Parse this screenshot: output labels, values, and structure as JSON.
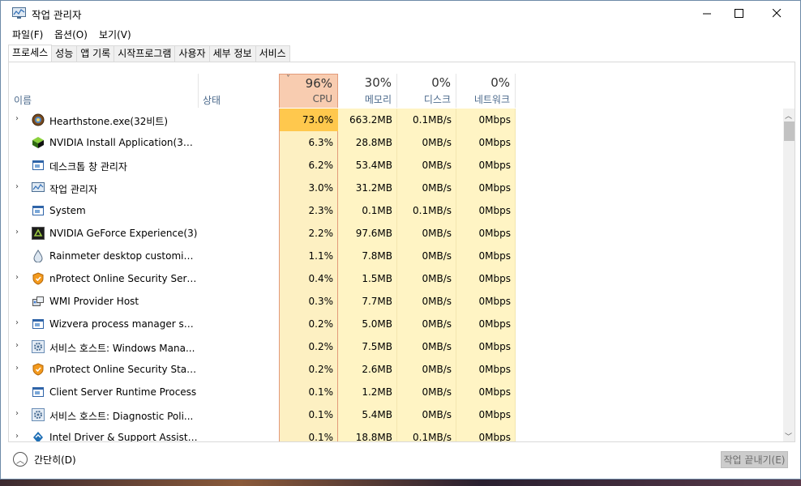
{
  "window": {
    "title": "작업 관리자"
  },
  "menu": [
    "파일(F)",
    "옵션(O)",
    "보기(V)"
  ],
  "tabs": [
    "프로세스",
    "성능",
    "앱 기록",
    "시작프로그램",
    "사용자",
    "세부 정보",
    "서비스"
  ],
  "header": {
    "name": "이름",
    "status": "상태",
    "cpu": {
      "pct": "96%",
      "label": "CPU"
    },
    "memory": {
      "pct": "30%",
      "label": "메모리"
    },
    "disk": {
      "pct": "0%",
      "label": "디스크"
    },
    "network": {
      "pct": "0%",
      "label": "네트워크"
    }
  },
  "processes": [
    {
      "name": "Hearthstone.exe(32비트)",
      "cpu": "73.0%",
      "mem": "663.2MB",
      "disk": "0.1MB/s",
      "net": "0Mbps",
      "icon": "hearthstone-icon"
    },
    {
      "name": "NVIDIA Install Application(32...",
      "cpu": "6.3%",
      "mem": "28.8MB",
      "disk": "0MB/s",
      "net": "0Mbps",
      "icon": "nvidia-cube-icon"
    },
    {
      "name": "데스크톱 창 관리자",
      "cpu": "6.2%",
      "mem": "53.4MB",
      "disk": "0MB/s",
      "net": "0Mbps",
      "icon": "window-icon"
    },
    {
      "name": "작업 관리자",
      "cpu": "3.0%",
      "mem": "31.2MB",
      "disk": "0MB/s",
      "net": "0Mbps",
      "icon": "task-manager-icon"
    },
    {
      "name": "System",
      "cpu": "2.3%",
      "mem": "0.1MB",
      "disk": "0.1MB/s",
      "net": "0Mbps",
      "icon": "window-icon"
    },
    {
      "name": "NVIDIA GeForce Experience(3)",
      "cpu": "2.2%",
      "mem": "97.6MB",
      "disk": "0MB/s",
      "net": "0Mbps",
      "icon": "geforce-icon"
    },
    {
      "name": "Rainmeter desktop customizati...",
      "cpu": "1.1%",
      "mem": "7.8MB",
      "disk": "0MB/s",
      "net": "0Mbps",
      "icon": "drop-icon"
    },
    {
      "name": "nProtect Online Security Servic...",
      "cpu": "0.4%",
      "mem": "1.5MB",
      "disk": "0MB/s",
      "net": "0Mbps",
      "icon": "shield-icon"
    },
    {
      "name": "WMI Provider Host",
      "cpu": "0.3%",
      "mem": "7.7MB",
      "disk": "0MB/s",
      "net": "0Mbps",
      "icon": "wmi-icon"
    },
    {
      "name": "Wizvera process manager servi...",
      "cpu": "0.2%",
      "mem": "5.0MB",
      "disk": "0MB/s",
      "net": "0Mbps",
      "icon": "window-icon"
    },
    {
      "name": "서비스 호스트: Windows Mana...",
      "cpu": "0.2%",
      "mem": "7.5MB",
      "disk": "0MB/s",
      "net": "0Mbps",
      "icon": "gear-icon"
    },
    {
      "name": "nProtect Online Security Starte...",
      "cpu": "0.2%",
      "mem": "2.6MB",
      "disk": "0MB/s",
      "net": "0Mbps",
      "icon": "shield-icon"
    },
    {
      "name": "Client Server Runtime Process",
      "cpu": "0.1%",
      "mem": "1.2MB",
      "disk": "0MB/s",
      "net": "0Mbps",
      "icon": "window-icon"
    },
    {
      "name": "서비스 호스트: Diagnostic Poli...",
      "cpu": "0.1%",
      "mem": "5.4MB",
      "disk": "0MB/s",
      "net": "0Mbps",
      "icon": "gear-icon"
    },
    {
      "name": "Intel Driver & Support Assistan...",
      "cpu": "0.1%",
      "mem": "18.8MB",
      "disk": "0.1MB/s",
      "net": "0Mbps",
      "icon": "intel-icon"
    }
  ],
  "footer": {
    "fewer": "간단히(D)",
    "end_task": "작업 끝내기(E)"
  },
  "colors": {
    "cpu_hot": "#ffc84d",
    "cpu_col": "#fdf2c3",
    "col": "#fff4c4",
    "cpu_header": "#f8ccb0"
  }
}
